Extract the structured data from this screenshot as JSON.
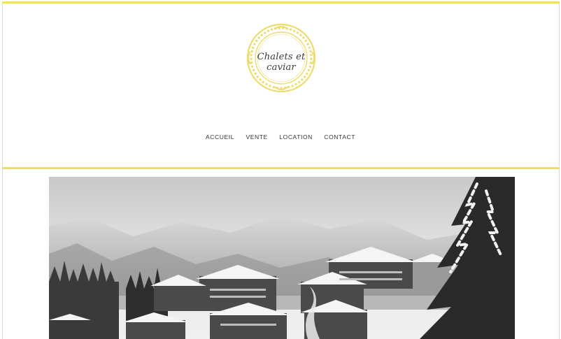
{
  "brand": {
    "logo_text": "Chalets et caviar",
    "accent_color": "#eedc6e"
  },
  "nav": {
    "items": [
      {
        "label": "ACCUEIL"
      },
      {
        "label": "VENTE"
      },
      {
        "label": "LOCATION"
      },
      {
        "label": "CONTACT"
      }
    ]
  },
  "hero": {
    "icon": "snowy-chalet-village-photo"
  }
}
